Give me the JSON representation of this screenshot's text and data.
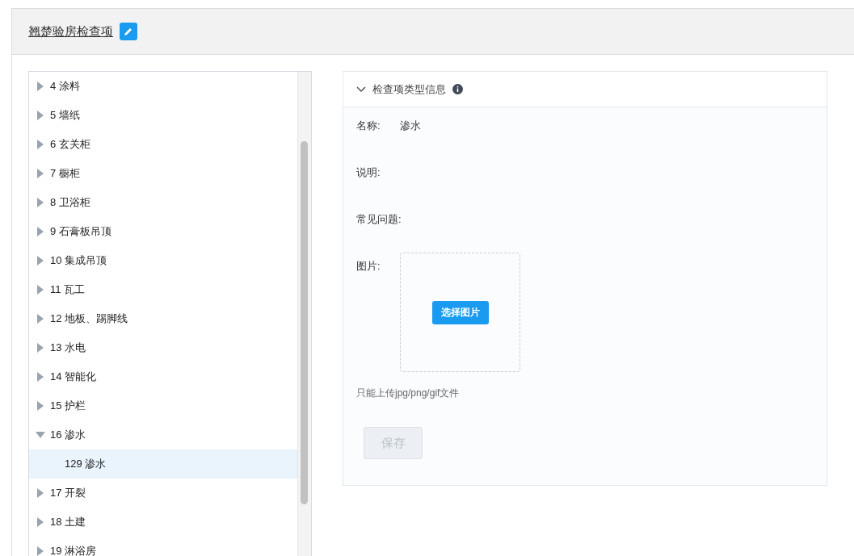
{
  "header": {
    "title": "翘楚验房检查项"
  },
  "tree": [
    {
      "label": "4 涂料",
      "expanded": false,
      "selected": false
    },
    {
      "label": "5 墙纸",
      "expanded": false,
      "selected": false
    },
    {
      "label": "6 玄关柜",
      "expanded": false,
      "selected": false
    },
    {
      "label": "7 橱柜",
      "expanded": false,
      "selected": false
    },
    {
      "label": "8 卫浴柜",
      "expanded": false,
      "selected": false
    },
    {
      "label": "9 石膏板吊顶",
      "expanded": false,
      "selected": false
    },
    {
      "label": "10 集成吊顶",
      "expanded": false,
      "selected": false
    },
    {
      "label": "11 瓦工",
      "expanded": false,
      "selected": false
    },
    {
      "label": "12 地板、踢脚线",
      "expanded": false,
      "selected": false
    },
    {
      "label": "13 水电",
      "expanded": false,
      "selected": false
    },
    {
      "label": "14 智能化",
      "expanded": false,
      "selected": false
    },
    {
      "label": "15 护栏",
      "expanded": false,
      "selected": false
    },
    {
      "label": "16 渗水",
      "expanded": true,
      "selected": false,
      "children": [
        {
          "label": "129 渗水",
          "selected": true
        }
      ]
    },
    {
      "label": "17 开裂",
      "expanded": false,
      "selected": false
    },
    {
      "label": "18 土建",
      "expanded": false,
      "selected": false
    },
    {
      "label": "19 淋浴房",
      "expanded": false,
      "selected": false
    }
  ],
  "detail": {
    "section_title": "检查项类型信息",
    "expanded": true,
    "fields": [
      {
        "label": "名称:",
        "value": "渗水"
      },
      {
        "label": "说明:"
      },
      {
        "label": "常见问题:"
      }
    ],
    "image_label": "图片:",
    "upload_button": "选择图片",
    "upload_hint": "只能上传jpg/png/gif文件",
    "save_button": {
      "label": "保存",
      "disabled": true
    }
  }
}
